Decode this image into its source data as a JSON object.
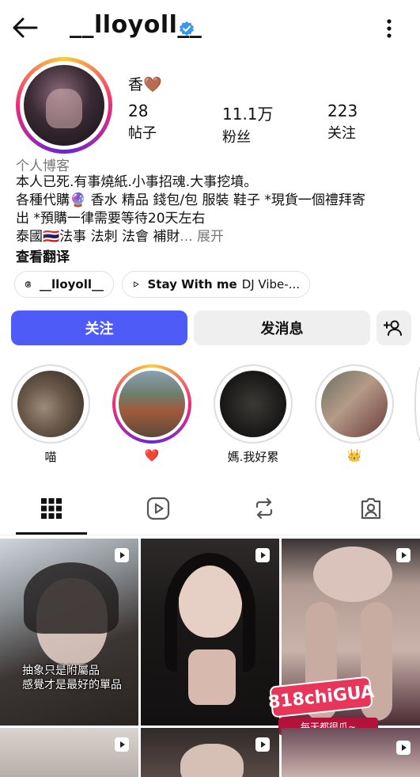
{
  "header": {
    "username": "__lloyoll__",
    "back_icon": "back-arrow-icon",
    "verified_icon": "verified-badge-icon",
    "more_icon": "more-vertical-icon"
  },
  "profile": {
    "display_name": "香🤎",
    "stats": [
      {
        "value": "28",
        "label": "帖子"
      },
      {
        "value": "11.1万",
        "label": "粉丝"
      },
      {
        "value": "223",
        "label": "关注"
      }
    ],
    "category": "个人博客",
    "bio_lines": [
      "本人已死.有事燒紙.小事招魂.大事挖墳。",
      "各種代購🔮 香水 精品 錢包/包 服裝 鞋子 *現貨一個禮拜寄",
      "出 *預購一律需要等待20天左右"
    ],
    "bio_last_line": "泰國🇹🇭法事 法刺 法會 補財",
    "bio_ellipsis": "...",
    "bio_more": "展开",
    "translate": "查看翻译"
  },
  "chips": {
    "threads_label": "__lloyoll__",
    "music_title": "Stay With me",
    "music_sub": "DJ Vibe-..."
  },
  "actions": {
    "follow": "关注",
    "message": "发消息"
  },
  "highlights": [
    {
      "label": "喵"
    },
    {
      "label": "❤️"
    },
    {
      "label": "媽.我好累"
    },
    {
      "label": "👑"
    }
  ],
  "grid_posts": {
    "caption_lines": [
      "抽象只是附屬品",
      "感覺才是最好的單品"
    ],
    "ad_badge": "818chiGUA",
    "ad_strip": "每天都很瓜~"
  },
  "colors": {
    "follow_bg": "#4f5bf6",
    "ring_gradient": "#ee2a7b",
    "verified": "#3897f0"
  }
}
